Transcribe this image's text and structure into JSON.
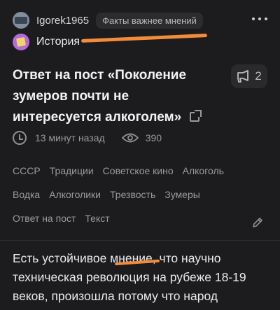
{
  "author": {
    "username": "Igorek1965",
    "status": "Факты важнее мнений"
  },
  "community": {
    "name": "История"
  },
  "post": {
    "title": "Ответ на пост «Поколение зумеров почти не интересуется алкоголем»",
    "comments_count": "2",
    "time_ago": "13 минут назад",
    "views": "390",
    "tags": [
      "СССР",
      "Традиции",
      "Советское кино",
      "Алкоголь",
      "Водка",
      "Алкоголики",
      "Трезвость",
      "Зумеры",
      "Ответ на пост",
      "Текст"
    ],
    "body_lines": [
      "Есть устойчивое мнение, что научно",
      "техническая революция на рубеже 18-19",
      "веков, произошла потому что народ"
    ]
  },
  "colors": {
    "background": "#1c1c1e",
    "highlight_underline": "#f28c3a",
    "community_icon": "#b46bd6"
  },
  "icons": [
    "avatar",
    "more-icon",
    "community-icon",
    "comment-icon",
    "external-link-icon",
    "clock-icon",
    "eye-icon",
    "pencil-icon"
  ]
}
